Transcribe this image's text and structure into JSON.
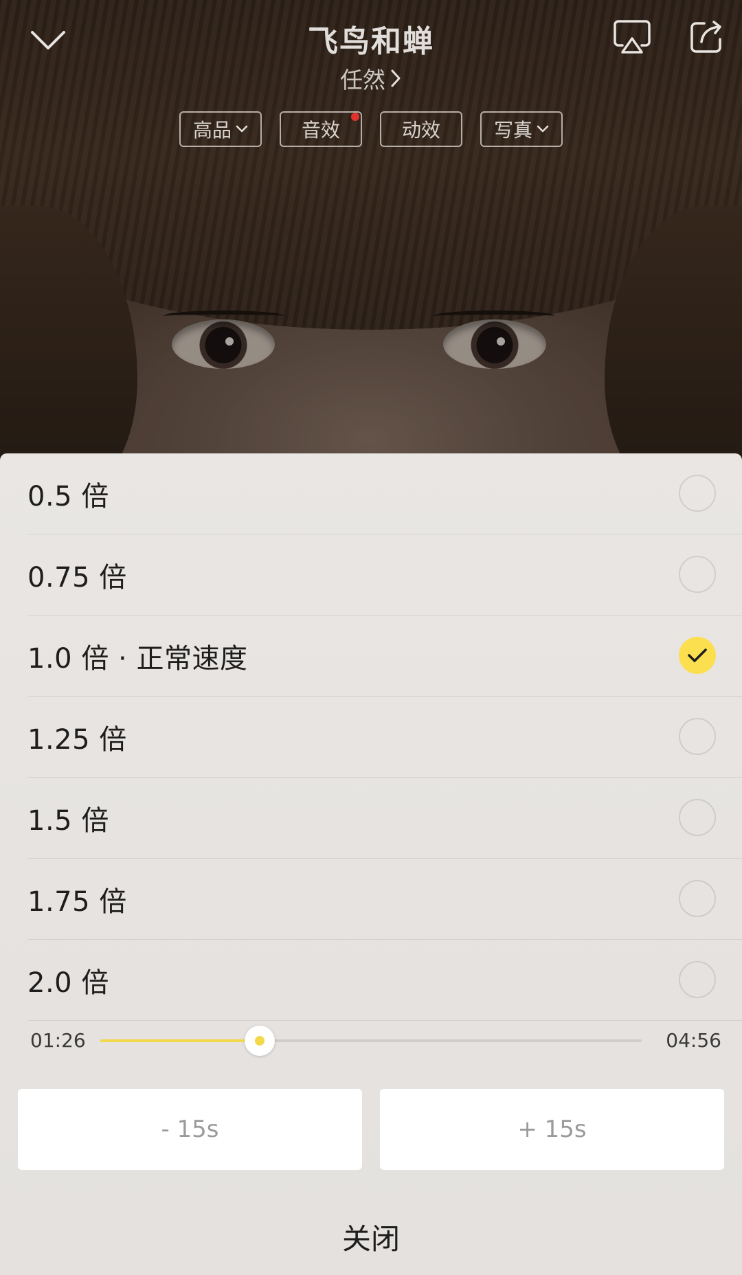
{
  "header": {
    "song_title": "飞鸟和蝉",
    "artist": "任然",
    "icons": {
      "collapse": "chevron-down-icon",
      "airplay": "airplay-icon",
      "share": "share-icon"
    },
    "chips": [
      {
        "label": "高品",
        "has_dropdown": true
      },
      {
        "label": "音效",
        "has_badge": true
      },
      {
        "label": "动效"
      },
      {
        "label": "写真",
        "has_dropdown": true
      }
    ]
  },
  "speed_options": [
    {
      "label": "0.5 倍",
      "selected": false
    },
    {
      "label": "0.75 倍",
      "selected": false
    },
    {
      "label": "1.0 倍 · 正常速度",
      "selected": true
    },
    {
      "label": "1.25 倍",
      "selected": false
    },
    {
      "label": "1.5 倍",
      "selected": false
    },
    {
      "label": "1.75 倍",
      "selected": false
    },
    {
      "label": "2.0 倍",
      "selected": false
    }
  ],
  "progress": {
    "current": "01:26",
    "total": "04:56",
    "fraction": 0.295
  },
  "seek": {
    "back_label": "- 15s",
    "forward_label": "+ 15s"
  },
  "close_label": "关闭",
  "colors": {
    "accent": "#fbdf4f",
    "badge": "#e0332f"
  }
}
